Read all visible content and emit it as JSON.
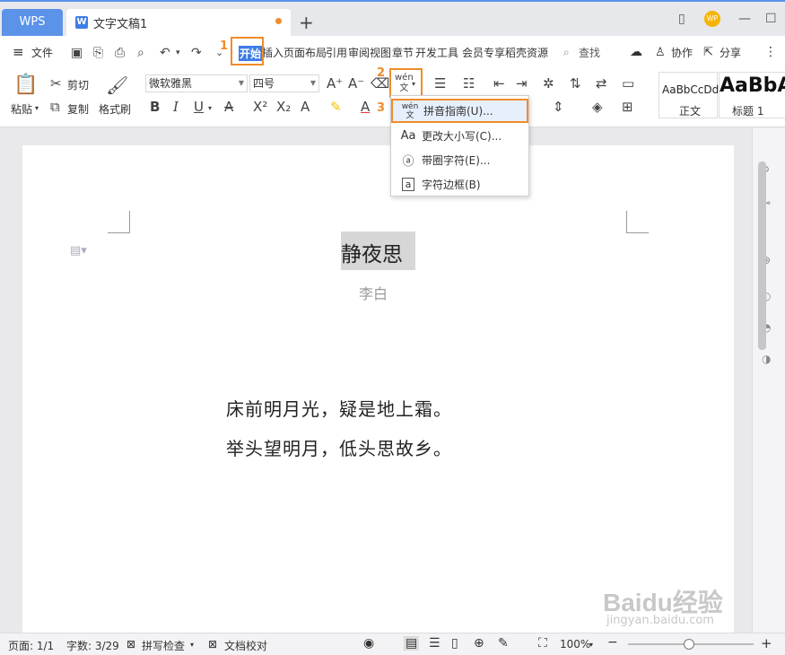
{
  "titlebar": {
    "wps_tab": "WPS",
    "doc_tab": "文字文稿1",
    "doc_icon": "W",
    "avatar": "WP"
  },
  "menubar": {
    "file": "文件",
    "start": "开始",
    "insert": "插入",
    "page": "页面布局",
    "ref": "引用",
    "review": "审阅",
    "view": "视图",
    "chapter": "章节",
    "dev": "开发工具",
    "member": "会员专享",
    "resource": "稻壳资源",
    "search": "查找",
    "collab": "协作",
    "share": "分享"
  },
  "ribbon": {
    "paste": "粘贴",
    "cut": "剪切",
    "copy": "复制",
    "format_painter": "格式刷",
    "font_name": "微软雅黑",
    "font_size": "四号",
    "style_normal_preview": "AaBbCcDd",
    "style_normal": "正文",
    "style_h1_preview": "AaBbA",
    "style_h1": "标题 1"
  },
  "annotations": {
    "n1": "1",
    "n2": "2",
    "n3": "3"
  },
  "dropdown": {
    "items": [
      {
        "icon": "wén",
        "label": "拼音指南(U)..."
      },
      {
        "icon": "Aa",
        "label": "更改大小写(C)..."
      },
      {
        "icon": "ⓐ",
        "label": "带圈字符(E)..."
      },
      {
        "icon": "a",
        "label": "字符边框(B)"
      }
    ]
  },
  "document": {
    "title": "静夜思",
    "author": "李白",
    "line1": "床前明月光，疑是地上霜。",
    "line2": "举头望明月，低头思故乡。"
  },
  "statusbar": {
    "page": "页面: 1/1",
    "words": "字数: 3/29",
    "spell": "拼写检查",
    "proof": "文档校对",
    "zoom": "100%"
  },
  "watermark": {
    "logo": "Baidu经验",
    "url": "jingyan.baidu.com"
  },
  "colors": {
    "accent": "#5b93e8",
    "highlight": "#f08c2b",
    "selection": "#3e7de6"
  }
}
